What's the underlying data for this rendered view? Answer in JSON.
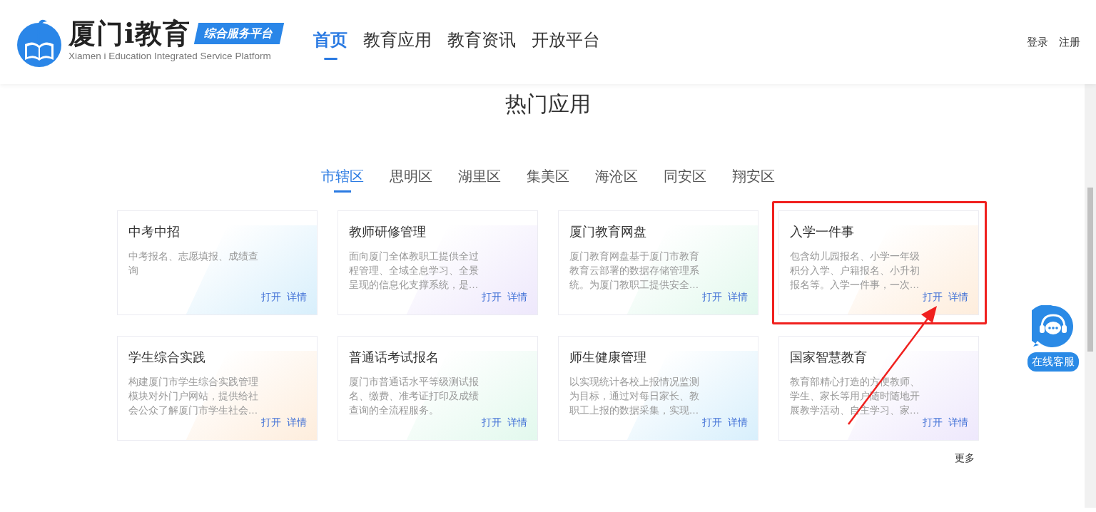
{
  "header": {
    "logo": {
      "title": "厦门i教育",
      "badge": "综合服务平台",
      "subtitle": "Xiamen i Education Integrated Service Platform"
    },
    "nav": [
      {
        "label": "首页",
        "selected": true
      },
      {
        "label": "教育应用",
        "selected": false
      },
      {
        "label": "教育资讯",
        "selected": false
      },
      {
        "label": "开放平台",
        "selected": false
      }
    ],
    "account": [
      "登录",
      "注册"
    ]
  },
  "section": {
    "title": "热门应用",
    "tabs": [
      {
        "label": "市辖区",
        "selected": true
      },
      {
        "label": "思明区",
        "selected": false
      },
      {
        "label": "湖里区",
        "selected": false
      },
      {
        "label": "集美区",
        "selected": false
      },
      {
        "label": "海沧区",
        "selected": false
      },
      {
        "label": "同安区",
        "selected": false
      },
      {
        "label": "翔安区",
        "selected": false
      }
    ],
    "apps": [
      {
        "title": "中考中招",
        "description": "中考报名、志愿填报、成绩查询",
        "actions": [
          "打开",
          "详情"
        ],
        "highlighted": false
      },
      {
        "title": "教师研修管理",
        "description": "面向厦门全体教职工提供全过程管理、全域全息学习、全景呈现的信息化支撑系统，是…",
        "actions": [
          "打开",
          "详情"
        ],
        "highlighted": false
      },
      {
        "title": "厦门教育网盘",
        "description": "厦门教育网盘基于厦门市教育教育云部署的数据存储管理系统。为厦门教职工提供安全…",
        "actions": [
          "打开",
          "详情"
        ],
        "highlighted": false
      },
      {
        "title": "入学一件事",
        "description": "包含幼儿园报名、小学一年级积分入学、户籍报名、小升初报名等。入学一件事，一次…",
        "actions": [
          "打开",
          "详情"
        ],
        "highlighted": true
      },
      {
        "title": "学生综合实践",
        "description": "构建厦门市学生综合实践管理模块对外门户网站，提供给社会公众了解厦门市学生社会…",
        "actions": [
          "打开",
          "详情"
        ],
        "highlighted": false
      },
      {
        "title": "普通话考试报名",
        "description": "厦门市普通话水平等级测试报名、缴费、准考证打印及成绩查询的全流程服务。",
        "actions": [
          "打开",
          "详情"
        ],
        "highlighted": false
      },
      {
        "title": "师生健康管理",
        "description": "以实现统计各校上报情况监测为目标，通过对每日家长、教职工上报的数据采集，实现…",
        "actions": [
          "打开",
          "详情"
        ],
        "highlighted": false
      },
      {
        "title": "国家智慧教育",
        "description": "教育部精心打造的方便教师、学生、家长等用户随时随地开展教学活动、自主学习、家…",
        "actions": [
          "打开",
          "详情"
        ],
        "highlighted": false
      }
    ],
    "more": "更多"
  },
  "support": {
    "label": "在线客服"
  }
}
